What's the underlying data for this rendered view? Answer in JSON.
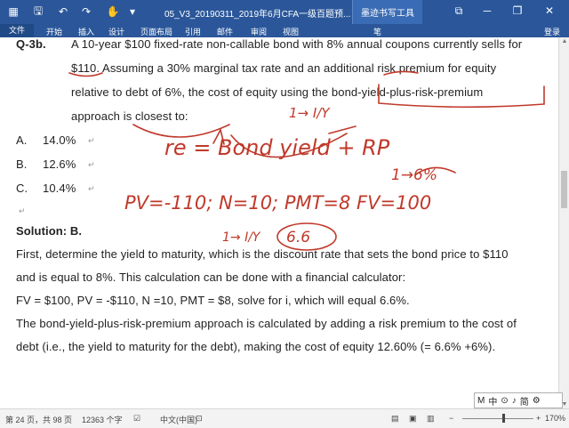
{
  "window": {
    "title": "05_V3_20190311_2019年6月CFA一级百题预...",
    "context_tab": "墨迹书写工具",
    "signin": "登录"
  },
  "ribbon": {
    "tabs": [
      "文件",
      "开始",
      "插入",
      "设计",
      "页面布局",
      "引用",
      "邮件",
      "审阅",
      "视图",
      "笔"
    ]
  },
  "document": {
    "question_label": "Q-3b.",
    "q_line1": "A 10-year $100 fixed-rate non-callable bond with 8% annual coupons currently sells for",
    "q_line2": "$110. Assuming a 30% marginal tax rate and an additional risk premium for equity",
    "q_line3": "relative to debt of 6%, the cost of equity using the bond-yield-plus-risk-premium",
    "q_line4": "approach is closest to:",
    "options": [
      {
        "letter": "A.",
        "text": "14.0%"
      },
      {
        "letter": "B.",
        "text": "12.6%"
      },
      {
        "letter": "C.",
        "text": "10.4%"
      }
    ],
    "solution_title": "Solution: B.",
    "sol_line1": "First, determine the yield to maturity, which is the discount rate that sets the bond price to $110",
    "sol_line2": "and is equal to 8%. This calculation can be done with a financial calculator:",
    "sol_line3": "FV = $100, PV = -$110, N =10, PMT = $8, solve for i, which will equal 6.6%.",
    "sol_line4": "The bond-yield-plus-risk-premium approach is calculated by adding a risk premium to the cost of",
    "sol_line5": "debt (i.e., the yield to maturity for the debt), making the cost of equity 12.60% (= 6.6% +6%).",
    "para_mark": "↵"
  },
  "ink": {
    "eq1": "re = Bond yield + RP",
    "eq2": "PV=-110; N=10; PMT=8  FV=100",
    "note1": "1→ I/Y",
    "note2": "1→6%",
    "note3": "1→ I/Y",
    "circled": "6.6"
  },
  "ime_bar": {
    "items": [
      "M",
      "中",
      "⊙",
      "♪",
      "简",
      "⚙"
    ]
  },
  "statusbar": {
    "page": "第 24 页，共 98 页",
    "words": "12363 个字",
    "language": "中文(中国)",
    "zoom": "170%"
  }
}
